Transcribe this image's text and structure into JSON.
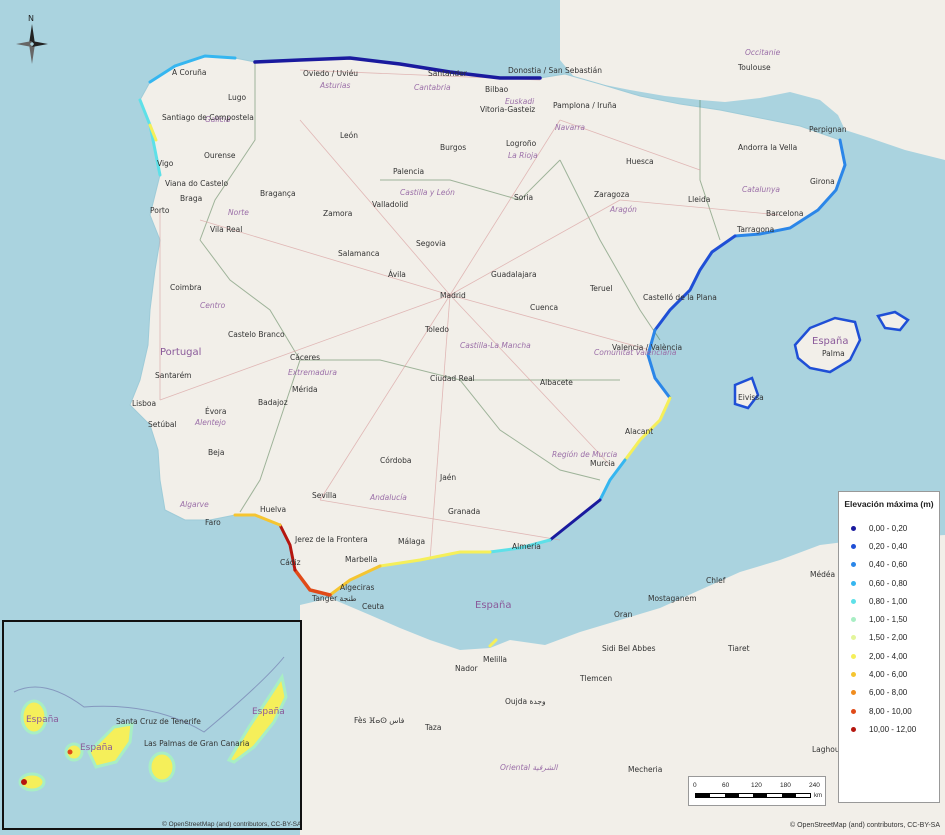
{
  "legend": {
    "title": "Elevación máxima (m)",
    "items": [
      {
        "label": "0,00 - 0,20",
        "color": "#1a1a9e"
      },
      {
        "label": "0,20 - 0,40",
        "color": "#1f4fd6"
      },
      {
        "label": "0,40 - 0,60",
        "color": "#2b86e8"
      },
      {
        "label": "0,60 - 0,80",
        "color": "#35b6f0"
      },
      {
        "label": "0,80 - 1,00",
        "color": "#5ee0e8"
      },
      {
        "label": "1,00 - 1,50",
        "color": "#a8eec4"
      },
      {
        "label": "1,50 - 2,00",
        "color": "#e3f59b"
      },
      {
        "label": "2,00 - 4,00",
        "color": "#f5ef5a"
      },
      {
        "label": "4,00 - 6,00",
        "color": "#f5c531"
      },
      {
        "label": "6,00 - 8,00",
        "color": "#f08d1f"
      },
      {
        "label": "8,00 - 10,00",
        "color": "#e04a18"
      },
      {
        "label": "10,00 - 12,00",
        "color": "#b5160f"
      }
    ]
  },
  "scale": {
    "ticks": [
      "0",
      "60",
      "120",
      "180",
      "240"
    ],
    "unit": "km"
  },
  "north_label": "N",
  "attribution": "© OpenStreetMap (and) contributors, CC-BY-SA",
  "inset_attribution": "© OpenStreetMap (and) contributors, CC-BY-SA",
  "map": {
    "countries": {
      "portugal": "Portugal",
      "espana_balearic": "España",
      "espana_sea": "España",
      "espana_canary1": "España",
      "espana_canary2": "España",
      "espana_canary3": "España"
    },
    "cities": {
      "coruna": "A Coruña",
      "santiago": "Santiago de Compostela",
      "lugo": "Lugo",
      "ourense": "Ourense",
      "vigo": "Vigo",
      "oviedo": "Oviedo / Uviéu",
      "santander": "Santander",
      "bilbao": "Bilbao",
      "sansebastian": "Donostia / San Sebastián",
      "vitoria": "Vitoria-Gasteiz",
      "pamplona": "Pamplona / Iruña",
      "leon": "León",
      "burgos": "Burgos",
      "logrono": "Logroño",
      "braga": "Braga",
      "porto": "Porto",
      "vianadocastelo": "Viana do Castelo",
      "vilareal": "Vila Real",
      "braganca": "Bragança",
      "zamora": "Zamora",
      "valladolid": "Valladolid",
      "palencia": "Palencia",
      "soria": "Soria",
      "zaragoza": "Zaragoza",
      "huesca": "Huesca",
      "lleida": "Lleida",
      "andorra": "Andorra la Vella",
      "girona": "Girona",
      "barcelona": "Barcelona",
      "tarragona": "Tarragona",
      "perpignan": "Perpignan",
      "toulouse": "Toulouse",
      "salamanca": "Salamanca",
      "segovia": "Segovia",
      "avila": "Ávila",
      "madrid": "Madrid",
      "guadalajara": "Guadalajara",
      "toledo": "Toledo",
      "cuenca": "Cuenca",
      "teruel": "Teruel",
      "castellon": "Castelló de la Plana",
      "valencia": "Valencia / València",
      "alicante": "Alacant",
      "albacete": "Albacete",
      "murcia": "Murcia",
      "ciudadreal": "Ciudad Real",
      "caceres": "Cáceres",
      "badajoz": "Badajoz",
      "merida": "Mérida",
      "coimbra": "Coimbra",
      "castelobranco": "Castelo Branco",
      "santarem": "Santarém",
      "lisboa": "Lisboa",
      "setubal": "Setúbal",
      "evora": "Évora",
      "beja": "Beja",
      "faro": "Faro",
      "huelva": "Huelva",
      "sevilla": "Sevilla",
      "cordoba": "Córdoba",
      "jaen": "Jaén",
      "granada": "Granada",
      "malaga": "Málaga",
      "marbella": "Marbella",
      "almeria": "Almería",
      "cadiz": "Cádiz",
      "jerez": "Jerez de la Frontera",
      "algeciras": "Algeciras",
      "tanger": "Tanger طنجة",
      "ceuta": "Ceuta",
      "melilla": "Melilla",
      "oran": "Oran",
      "sidibelabbes": "Sidi Bel Abbes",
      "tlemcen": "Tlemcen",
      "oujda": "Oujda وجدة",
      "nador": "Nador",
      "fes": "Fès ⴼⴰⵙ فاس",
      "taza": "Taza",
      "tiaret": "Tiaret",
      "mostaganem": "Mostaganem",
      "medea": "Médéa",
      "chlef": "Chlef",
      "laghouat": "Laghouat",
      "mecheria": "Mecheria",
      "palma": "Palma",
      "ibiza": "Eivissa",
      "santacruz": "Santa Cruz de Tenerife",
      "laspalmas": "Las Palmas de Gran Canaria"
    },
    "regions": {
      "galicia": "Galicia",
      "asturias": "Asturias",
      "cantabria": "Cantabria",
      "euskadi": "Euskadi",
      "navarra": "Navarra",
      "larioja": "La Rioja",
      "castillaleon": "Castilla y León",
      "aragon": "Aragón",
      "catalunya": "Catalunya",
      "norte": "Norte",
      "centro": "Centro",
      "alentejo": "Alentejo",
      "algarve": "Algarve",
      "extremadura": "Extremadura",
      "castillamancha": "Castilla-La Mancha",
      "comunidadvalenciana": "Comunitat Valenciana",
      "regionmurcia": "Región de Murcia",
      "andalucia": "Andalucía",
      "occitanie": "Occitanie",
      "oriental": "Oriental الشرقية"
    }
  }
}
